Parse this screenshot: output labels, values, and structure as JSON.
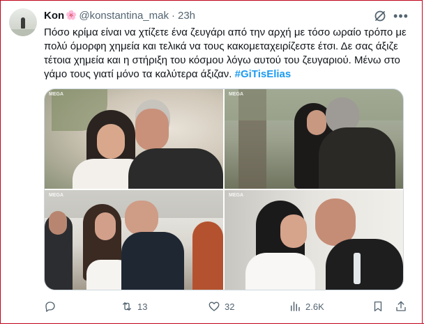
{
  "tweet": {
    "display_name": "Kon",
    "name_emoji": "🌸",
    "handle": "@konstantina_mak",
    "separator": "·",
    "time": "23h",
    "text": "Πόσο κρίμα είναι να χτίζετε ένα ζευγάρι από την αρχή με τόσο ωραίο τρόπο με πολύ όμορφη χημεία και τελικά να τους κακομεταχειρίζεστε έτσι. Δε σας άξιζε τέτοια χημεία και η στήριξη του κόσμου λόγω αυτού του ζευγαριού. Μένω στο γάμο τους γιατί μόνο τα καλύτερα άξιζαν.",
    "hashtag": "#GiTisElias",
    "media_logo": "MEGA"
  },
  "actions": {
    "replies": "",
    "retweets": "13",
    "likes": "32",
    "views": "2.6K"
  },
  "icons": {
    "grok": "grok-icon",
    "more": "more-icon",
    "reply": "reply-icon",
    "retweet": "retweet-icon",
    "like": "heart-icon",
    "views": "views-icon",
    "bookmark": "bookmark-icon",
    "share": "share-icon"
  },
  "colors": {
    "text": "#0f1419",
    "secondary": "#536471",
    "link": "#1d9bf0",
    "frame": "#c0001a"
  }
}
